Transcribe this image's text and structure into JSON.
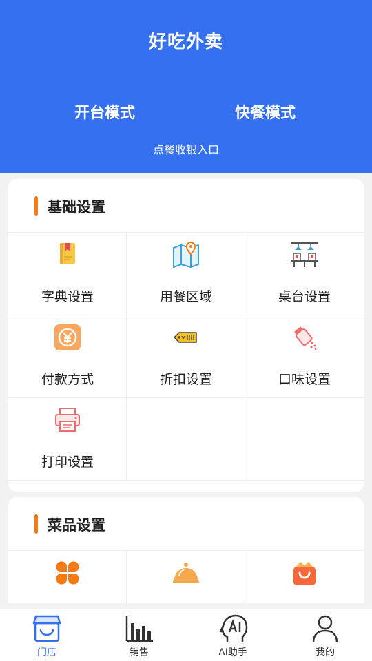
{
  "header": {
    "title": "好吃外卖",
    "modes": [
      "开台模式",
      "快餐模式"
    ],
    "entry": "点餐收银入口",
    "bg_color": "#3570f0"
  },
  "basic_settings": {
    "title": "基础设置",
    "items": [
      {
        "label": "字典设置",
        "icon": "dictionary-book-icon"
      },
      {
        "label": "用餐区域",
        "icon": "map-pin-icon"
      },
      {
        "label": "桌台设置",
        "icon": "dining-table-icon"
      },
      {
        "label": "付款方式",
        "icon": "yuan-payment-icon"
      },
      {
        "label": "折扣设置",
        "icon": "discount-tag-icon"
      },
      {
        "label": "口味设置",
        "icon": "seasoning-shaker-icon"
      },
      {
        "label": "打印设置",
        "icon": "printer-icon"
      }
    ]
  },
  "dish_settings": {
    "title": "菜品设置",
    "items": [
      {
        "label": "",
        "icon": "category-clover-icon"
      },
      {
        "label": "",
        "icon": "food-cloche-icon"
      },
      {
        "label": "",
        "icon": "shopping-bag-icon"
      }
    ]
  },
  "accent_color": "#f57a14",
  "nav": {
    "items": [
      {
        "label": "门店",
        "icon": "store-icon",
        "active": true
      },
      {
        "label": "销售",
        "icon": "bar-chart-icon",
        "active": false
      },
      {
        "label": "AI助手",
        "icon": "ai-head-icon",
        "active": false
      },
      {
        "label": "我的",
        "icon": "user-icon",
        "active": false
      }
    ]
  }
}
